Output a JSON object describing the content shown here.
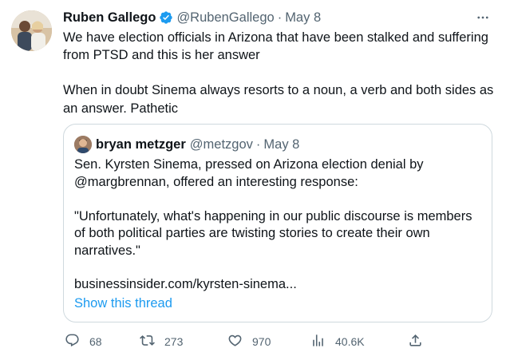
{
  "author": {
    "name": "Ruben Gallego",
    "handle": "@RubenGallego",
    "date": "May 8",
    "verified_color": "#1d9bf0"
  },
  "tweet": {
    "paragraph1": "We have election officials in Arizona that have been stalked and suffering from PTSD and this is her answer",
    "paragraph2": "When in doubt Sinema always resorts to a noun, a verb and both sides as an answer. Pathetic"
  },
  "quoted": {
    "name": "bryan metzger",
    "handle": "@metzgov",
    "date": "May 8",
    "paragraph1": "Sen. Kyrsten Sinema, pressed on Arizona election denial by @margbrennan, offered an interesting response:",
    "paragraph2": "\"Unfortunately, what's happening in our public discourse is members of both political parties are twisting stories to create their own narratives.\"",
    "link": "businessinsider.com/kyrsten-sinema...",
    "show_thread": "Show this thread"
  },
  "actions": {
    "replies": "68",
    "retweets": "273",
    "likes": "970",
    "views": "40.6K",
    "reply_icon": "reply-icon",
    "retweet_icon": "retweet-icon",
    "like_icon": "heart-icon",
    "views_icon": "views-icon",
    "share_icon": "share-icon"
  },
  "colors": {
    "text": "#0f1419",
    "secondary": "#536471",
    "accent": "#1d9bf0",
    "border": "#cfd9de"
  }
}
